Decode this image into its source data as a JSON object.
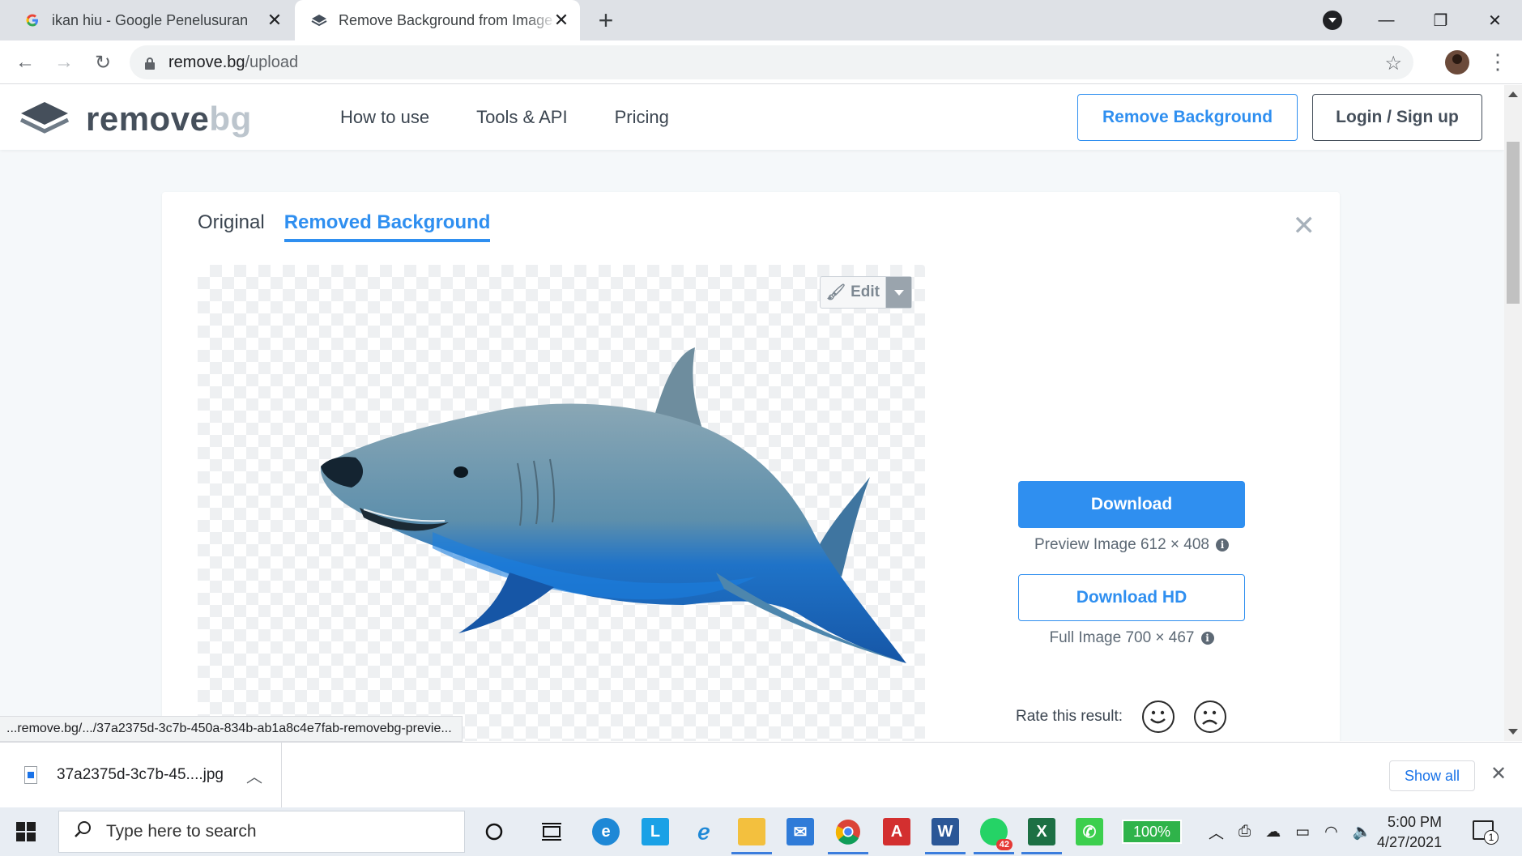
{
  "browser": {
    "tabs": [
      {
        "title": "ikan hiu - Google Penelusuran",
        "active": false
      },
      {
        "title": "Remove Background from Image",
        "active": true
      }
    ],
    "url_domain": "remove.bg",
    "url_path": "/upload"
  },
  "site": {
    "logo_main": "remove",
    "logo_accent": "bg",
    "nav": [
      "How to use",
      "Tools & API",
      "Pricing"
    ],
    "remove_bg_button": "Remove Background",
    "login_button": "Login / Sign up"
  },
  "editor": {
    "tabs": [
      "Original",
      "Removed Background"
    ],
    "active_tab": "Removed Background",
    "edit_label": "Edit",
    "download_label": "Download",
    "preview_info": "Preview Image 612 × 408",
    "download_hd_label": "Download HD",
    "full_info": "Full Image 700 × 467",
    "rate_label": "Rate this result:"
  },
  "status_url": "...remove.bg/.../37a2375d-3c7b-450a-834b-ab1a8c4e7fab-removebg-previe...",
  "downloads": {
    "file_name": "37a2375d-3c7b-45....jpg",
    "show_all": "Show all"
  },
  "taskbar": {
    "search_placeholder": "Type here to search",
    "whatsapp_badge": "42",
    "battery": "100%",
    "time": "5:00 PM",
    "date": "4/27/2021",
    "notifications": "1"
  },
  "colors": {
    "accent": "#2f8ff0",
    "logo_dark": "#454f5b"
  }
}
